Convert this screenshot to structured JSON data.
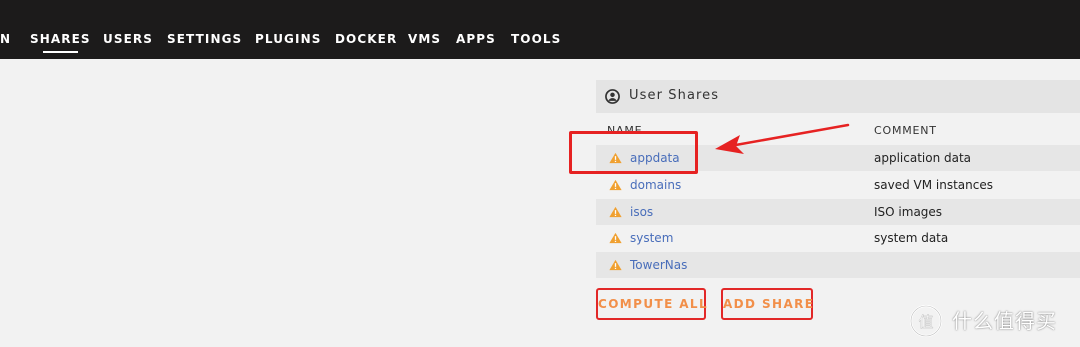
{
  "nav": {
    "items": [
      {
        "label": "N",
        "active": false
      },
      {
        "label": "SHARES",
        "active": true
      },
      {
        "label": "USERS",
        "active": false
      },
      {
        "label": "SETTINGS",
        "active": false
      },
      {
        "label": "PLUGINS",
        "active": false
      },
      {
        "label": "DOCKER",
        "active": false
      },
      {
        "label": "VMS",
        "active": false
      },
      {
        "label": "APPS",
        "active": false
      },
      {
        "label": "TOOLS",
        "active": false
      }
    ]
  },
  "panel": {
    "title": "User Shares",
    "icon": "user-circle-icon",
    "columns": {
      "name": "NAME",
      "comment": "COMMENT"
    },
    "shares": [
      {
        "name": "appdata",
        "comment": "application data",
        "icon": "warning-icon"
      },
      {
        "name": "domains",
        "comment": "saved VM instances",
        "icon": "warning-icon"
      },
      {
        "name": "isos",
        "comment": "ISO images",
        "icon": "warning-icon"
      },
      {
        "name": "system",
        "comment": "system data",
        "icon": "warning-icon"
      },
      {
        "name": "TowerNas",
        "comment": "",
        "icon": "warning-icon"
      }
    ]
  },
  "buttons": {
    "compute_all": "COMPUTE ALL",
    "add_share": "ADD SHARE"
  },
  "watermark": {
    "text": "什么值得买",
    "logo_text": "值"
  },
  "colors": {
    "nav_bg": "#1c1b1b",
    "page_bg": "#f2f2f2",
    "link": "#486dba",
    "warning": "#f0a030",
    "button_text": "#f28f49",
    "annotation": "#e62222"
  }
}
